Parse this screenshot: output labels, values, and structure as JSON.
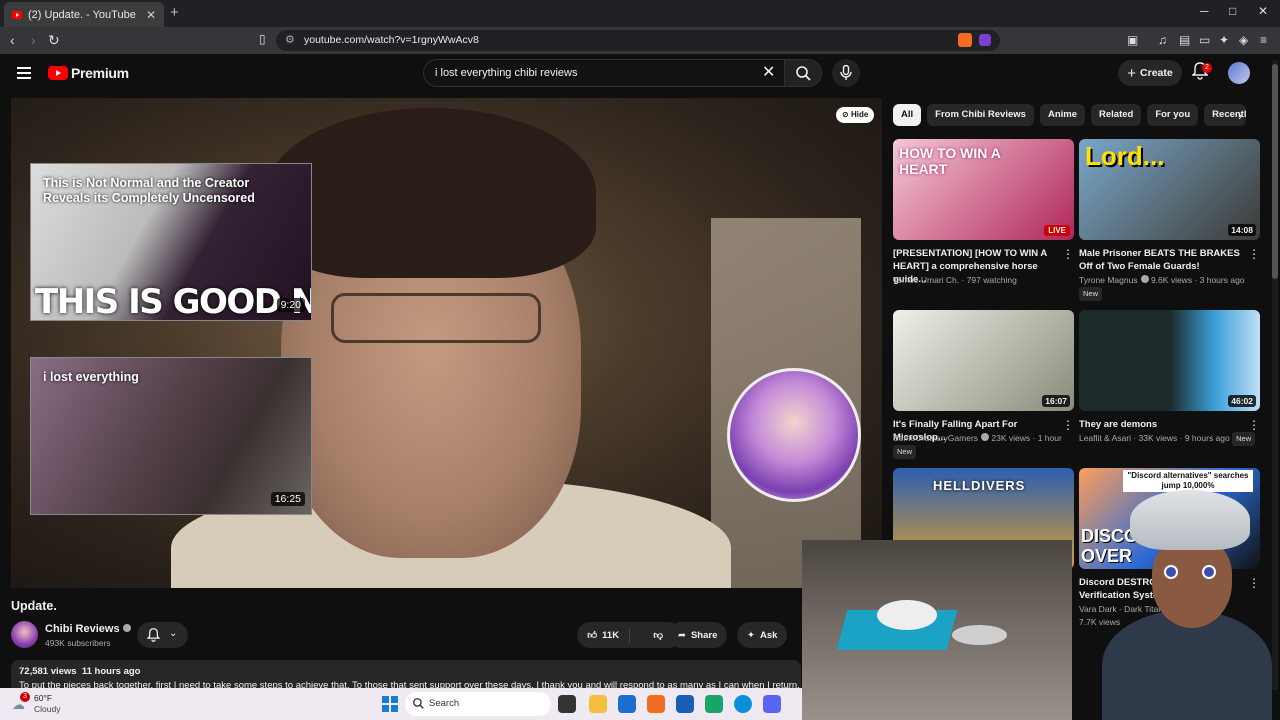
{
  "browser": {
    "tab_title": "(2) Update. - YouTube",
    "url": "youtube.com/watch?v=1rgnyWwAcv8",
    "new_tab": "+",
    "minimize": "─",
    "maximize": "□",
    "close": "✕"
  },
  "header": {
    "brand": "Premium",
    "search_value": "i lost everything chibi reviews",
    "create_label": "Create",
    "notification_count": "2"
  },
  "player": {
    "hide_label": "Hide",
    "endcards": [
      {
        "title": "This is Not Normal and the Creator Reveals its Completely Uncensored",
        "overlay_text": "THIS IS GOOD NEWS",
        "duration": "9:20"
      },
      {
        "title": "i lost everything",
        "duration": "16:25"
      }
    ]
  },
  "video": {
    "title": "Update.",
    "channel": "Chibi Reviews",
    "subscribers": "493K subscribers",
    "likes": "11K",
    "share_label": "Share",
    "ask_label": "Ask",
    "views": "72,581 views",
    "age": "11 hours ago",
    "description": "To put the pieces back together, first I need to take some steps to achieve that. To those that sent support over these days, I thank you and will respond to as many as I can when I return."
  },
  "chips": [
    "All",
    "From Chibi Reviews",
    "Anime",
    "Related",
    "For you",
    "Recently uploaded"
  ],
  "recommendations": [
    {
      "title": "[PRESENTATION] [HOW TO WIN A HEART] a comprehensive horse guide...",
      "channel": "Tomoe Umari Ch.",
      "stats": "797 watching",
      "badge": "LIVE",
      "thumb_text": "HOW TO WIN A HEART",
      "color1": "#f5c8d8",
      "color2": "#b0265a"
    },
    {
      "title": "Male Prisoner BEATS THE BRAKES Off of Two Female Guards!",
      "channel": "Tyrone Magnus",
      "stats": "9.6K views · 3 hours ago",
      "duration": "14:08",
      "new": "New",
      "thumb_text": "Lord...",
      "color1": "#7aa7c9",
      "color2": "#3c3a36"
    },
    {
      "title": "It's Finally Falling Apart For Microslop...",
      "channel": "SomeOrdinaryGamers",
      "stats": "23K views · 1 hour ago",
      "duration": "16:07",
      "new": "New",
      "color1": "#f0efe9",
      "color2": "#8a8a7a"
    },
    {
      "title": "They are demons",
      "channel": "Leaflit & Asari",
      "stats": "33K views · 9 hours ago",
      "duration": "46:02",
      "new": "New",
      "color1": "#1c2a2a",
      "color2": "#3aa0d8"
    },
    {
      "title": "Discord DESTROYS Itself... Verification System",
      "channel": "Vara Dark - Dark Titan Media",
      "stats": "7.7K views",
      "thumb_text": "DISCORD OVER",
      "caption": "\"Discord alternatives\" searches jump 10,000%",
      "color1": "#2b6bd6",
      "color2": "#111"
    },
    {
      "title": "",
      "channel": "",
      "stats": "",
      "thumb_text": "HELLDIVERS",
      "color1": "#2c5fb0",
      "color2": "#d8a030"
    }
  ],
  "taskbar": {
    "weather_badge": "3",
    "temperature": "60°F",
    "condition": "Cloudy",
    "search_label": "Search"
  },
  "colors": {
    "accent": "#ff0000",
    "bg": "#0f0f0f"
  }
}
